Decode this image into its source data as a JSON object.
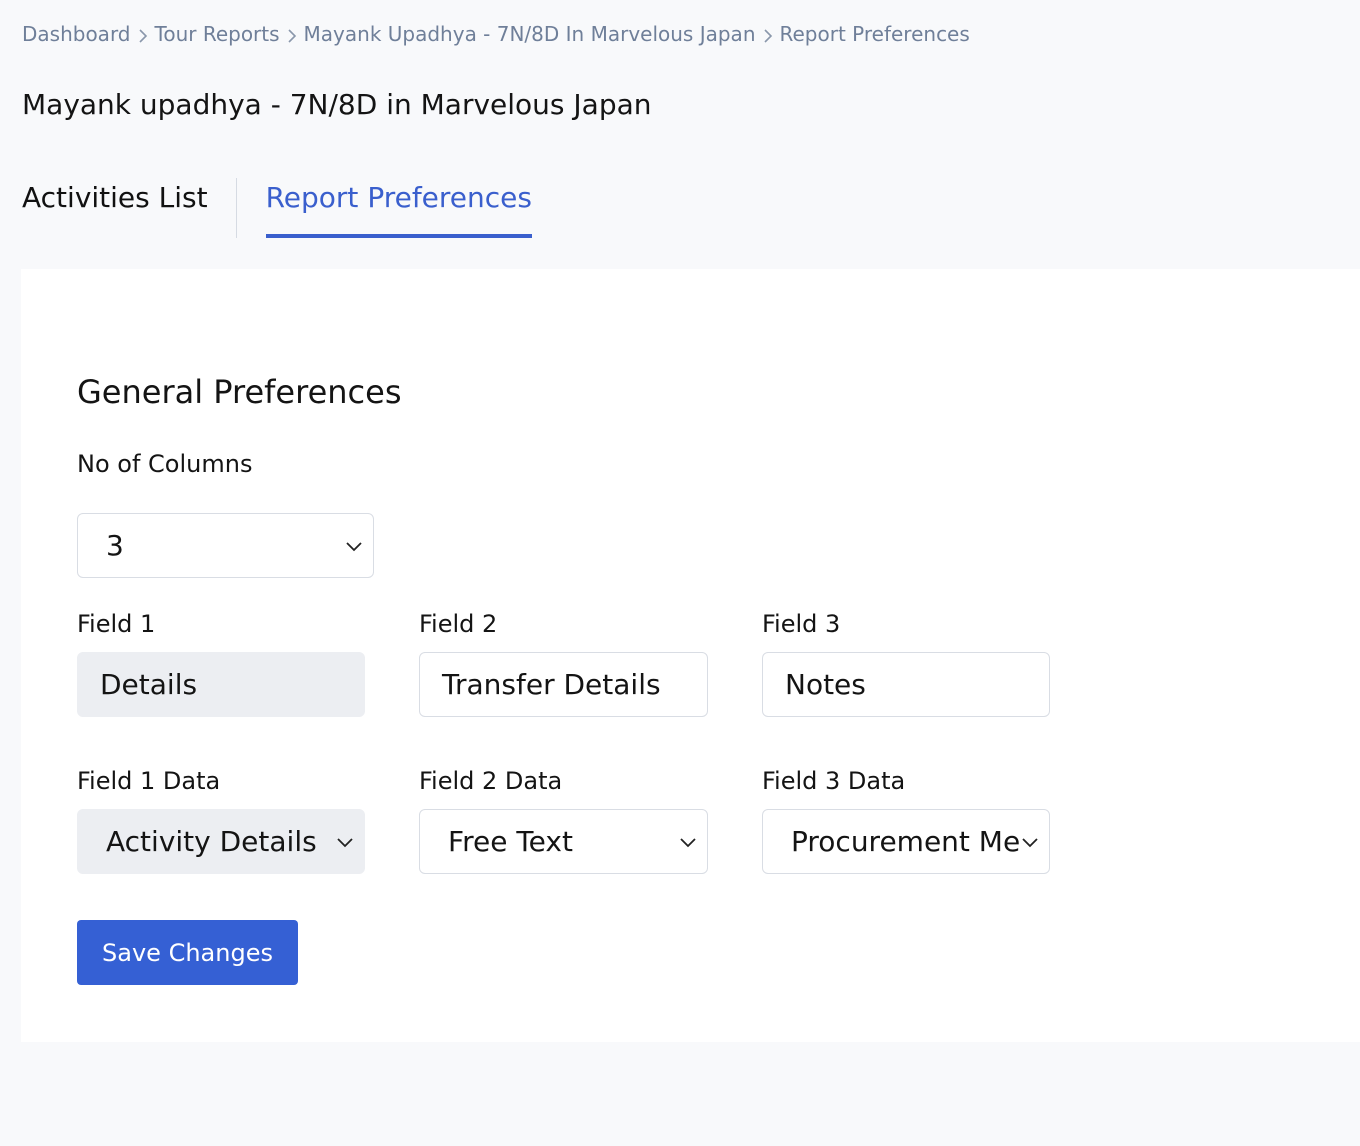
{
  "breadcrumb": {
    "items": [
      "Dashboard",
      "Tour Reports",
      "Mayank Upadhya - 7N/8D In Marvelous Japan",
      "Report Preferences"
    ]
  },
  "page_title": "Mayank upadhya - 7N/8D in Marvelous Japan",
  "tabs": {
    "activities": "Activities List",
    "preferences": "Report Preferences",
    "active": "Report Preferences"
  },
  "general": {
    "title": "General Preferences",
    "columns_label": "No of Columns",
    "columns_value": "3"
  },
  "fields": {
    "f1_label": "Field 1",
    "f1_value": "Details",
    "f2_label": "Field 2",
    "f2_value": "Transfer Details",
    "f3_label": "Field 3",
    "f3_value": "Notes",
    "f1_data_label": "Field 1 Data",
    "f1_data_value": "Activity Details",
    "f2_data_label": "Field 2 Data",
    "f2_data_value": "Free Text",
    "f3_data_label": "Field 3 Data",
    "f3_data_value": "Procurement Men"
  },
  "actions": {
    "save_label": "Save Changes"
  },
  "colors": {
    "accent": "#3a5fcd",
    "button": "#3560d4",
    "page_bg": "#f8f9fb",
    "disabled_bg": "#eceef2"
  }
}
